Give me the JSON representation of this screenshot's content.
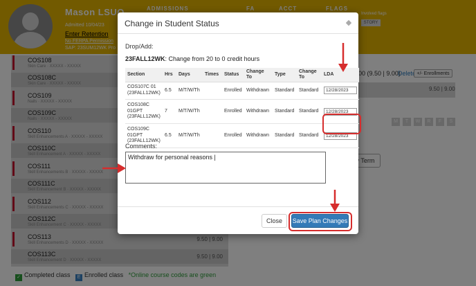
{
  "header": {
    "student_name": "Mason LSUO",
    "admitted": "Admitted 10/04/23",
    "enter_retention": "Enter Retention",
    "ferpa_text": "No FERPA Permission",
    "sap_text": "SAP: 23SUM12WK Pro",
    "nav_admissions": "ADMISSIONS",
    "nav_fa": "FA",
    "nav_acct": "ACCT",
    "nav_flags": "FLAGS",
    "involved_flags": "Involved flags",
    "history": "STORY"
  },
  "courses": [
    {
      "code": "COS108",
      "sub": "Skin Care · XXXXX - XXXXX",
      "credit": ""
    },
    {
      "code": "COS108C",
      "sub": "Skin Care · XXXXX - XXXXX",
      "credit": ""
    },
    {
      "code": "COS109",
      "sub": "Nails · XXXXX - XXXXX",
      "credit": ""
    },
    {
      "code": "COS109C",
      "sub": "Nails · XXXXX - XXXXX",
      "credit": ""
    },
    {
      "code": "COS110",
      "sub": "Skill Enhancements A · XXXXX - XXXXX",
      "credit": ""
    },
    {
      "code": "COS110C",
      "sub": "Skill Enhancement A · XXXXX - XXXXX",
      "credit": ""
    },
    {
      "code": "COS111",
      "sub": "Skill Enhancements B · XXXXX - XXXXX",
      "credit": ""
    },
    {
      "code": "COS111C",
      "sub": "Skill Enhancement B · XXXXX - XXXXX",
      "credit": ""
    },
    {
      "code": "COS112",
      "sub": "Skill Enhancements C · XXXXX - XXXXX",
      "credit": ""
    },
    {
      "code": "COS112C",
      "sub": "Skill Enhancement C · XXXXX - XXXXX",
      "credit": ""
    },
    {
      "code": "COS113",
      "sub": "Skill Enhancements D · XXXXX - XXXXX",
      "credit": "9.50 | 9.00"
    },
    {
      "code": "COS113C",
      "sub": "Skill Enhancement D · XXXXX - XXXXX",
      "credit": "9.50 | 9.00"
    }
  ],
  "background_right": {
    "credit_text": "00 (9.50 | 9.00)",
    "delete_label": "Delete",
    "enrollments_label": "+/- Enrollments",
    "credit_grey": "9.50 | 9.00",
    "days": [
      "M",
      "T",
      "W",
      "R",
      "F",
      "S"
    ],
    "term_button": "v Term"
  },
  "legend": {
    "completed": "Completed class",
    "enrolled": "Enrolled class",
    "note": "*Online course codes are green"
  },
  "modal": {
    "title": "Change in Student Status",
    "drop_add_label": "Drop/Add:",
    "term_code": "23FALL12WK",
    "change_text": ": Change from 20 to 0 credit hours",
    "columns": [
      "Section",
      "Hrs",
      "Days",
      "Times",
      "Status",
      "Change To",
      "Type",
      "Change To",
      "LDA"
    ],
    "rows": [
      {
        "section": "COS107C 01 (23FALL12WK)",
        "hrs": "6.5",
        "days": "M/T/W/Th",
        "times": "",
        "status": "Enrolled",
        "change_to": "Withdrawn",
        "type": "Standard",
        "change_to_type": "Standard",
        "lda": "12/28/2023"
      },
      {
        "section": "COS108C 01GPT (23FALL12WK)",
        "hrs": "7",
        "days": "M/T/W/Th",
        "times": "",
        "status": "Enrolled",
        "change_to": "Withdrawn",
        "type": "Standard",
        "change_to_type": "Standard",
        "lda": "12/28/2023"
      },
      {
        "section": "COS109C 01GPT (23FALL12WK)",
        "hrs": "6.5",
        "days": "M/T/W/Th",
        "times": "",
        "status": "Enrolled",
        "change_to": "Withdrawn",
        "type": "Standard",
        "change_to_type": "Standard",
        "lda": "12/28/2023"
      }
    ],
    "comments_label": "Comments:",
    "comments_value": "Withdraw for personal reasons |",
    "close_label": "Close",
    "save_label": "Save Plan Changes"
  },
  "colors": {
    "header_bg": "#e5b400",
    "accent_blue": "#337ab7",
    "annotation_red": "#d62d2d",
    "course_bar": "#c4122f"
  }
}
